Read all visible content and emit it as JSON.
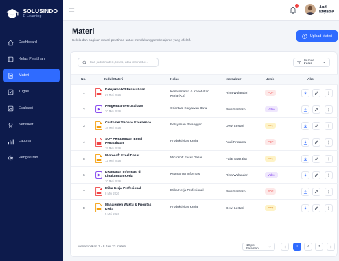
{
  "brand": {
    "name": "SOLUSINDO",
    "sub": "E-Learning"
  },
  "nav": [
    {
      "label": "Dashboard",
      "icon": "home-icon",
      "active": false
    },
    {
      "label": "Kelas Pelatihan",
      "icon": "class-icon",
      "active": false
    },
    {
      "label": "Materi",
      "icon": "document-icon",
      "active": true
    },
    {
      "label": "Tugas",
      "icon": "task-icon",
      "active": false
    },
    {
      "label": "Evaluasi",
      "icon": "evaluation-icon",
      "active": false
    },
    {
      "label": "Sertifikat",
      "icon": "certificate-icon",
      "active": false
    },
    {
      "label": "Laporan",
      "icon": "report-icon",
      "active": false
    },
    {
      "label": "Pengaturan",
      "icon": "settings-icon",
      "active": false
    }
  ],
  "user": {
    "name": "Andi Pratama",
    "role": "Karyawan"
  },
  "page": {
    "title": "Materi",
    "subtitle": "Kelola dan bagikan materi pelatihan untuk mendukung pembelajaran yang efektif.",
    "upload_label": "Upload Materi"
  },
  "search": {
    "placeholder": "Cari judul materi, kelas, atau instruktur..."
  },
  "filter": {
    "label": "Semua Kelas"
  },
  "table": {
    "headers": {
      "no": "No.",
      "title": "Judul Materi",
      "kelas": "Kelas",
      "instruktur": "Instruktur",
      "jenis": "Jenis",
      "aksi": "Aksi"
    },
    "rows": [
      {
        "no": "1",
        "title": "Kebijakan K3 Perusahaan",
        "date": "27 Mei 2026",
        "kelas": "Keselamatan & Kesehatan Kerja (K3)",
        "instruktur": "Rina Wulandari",
        "jenis": "PDF",
        "file": "pdf"
      },
      {
        "no": "2",
        "title": "Pengenalan Perusahaan",
        "date": "20 Mei 2026",
        "kelas": "Orientasi Karyawan Baru",
        "instruktur": "Budi Santoso",
        "jenis": "Video",
        "file": "video"
      },
      {
        "no": "3",
        "title": "Customer Service Excellence",
        "date": "18 Mei 2026",
        "kelas": "Pelayanan Pelanggan",
        "instruktur": "Dewi Lestari",
        "jenis": "PPT",
        "file": "ppt"
      },
      {
        "no": "4",
        "title": "SOP Penggunaan Email Perusahaan",
        "date": "15 Mei 2026",
        "kelas": "Produktivitas Kerja",
        "instruktur": "Andi Pratama",
        "jenis": "PDF",
        "file": "pdf"
      },
      {
        "no": "5",
        "title": "Microsoft Excel Dasar",
        "date": "12 Mei 2026",
        "kelas": "Microsoft Excel Dasar",
        "instruktur": "Fajar Nugraha",
        "jenis": "PPT",
        "file": "ppt"
      },
      {
        "no": "6",
        "title": "Keamanan Informasi di Lingkungan Kerja",
        "date": "10 Mei 2026",
        "kelas": "Keamanan Informasi",
        "instruktur": "Rina Wulandari",
        "jenis": "Video",
        "file": "video"
      },
      {
        "no": "7",
        "title": "Etika Kerja Profesional",
        "date": "8 Mei 2026",
        "kelas": "Etika Kerja Profesional",
        "instruktur": "Budi Santoso",
        "jenis": "PDF",
        "file": "pdf"
      },
      {
        "no": "8",
        "title": "Manajemen Waktu & Prioritas Kerja",
        "date": "5 Mei 2026",
        "kelas": "Produktivitas Kerja",
        "instruktur": "Dewi Lestari",
        "jenis": "PPT",
        "file": "ppt"
      }
    ]
  },
  "footer": {
    "info": "Menampilkan 1 - 8 dari 23 materi",
    "per_page": "10 per halaman",
    "pages": [
      "1",
      "2",
      "3"
    ],
    "current_page": "1"
  },
  "colors": {
    "primary": "#2f6bff",
    "sidebar": "#0d1b4c",
    "pdf": "#ef4444",
    "video": "#7c3aed",
    "ppt": "#f59e0b"
  }
}
